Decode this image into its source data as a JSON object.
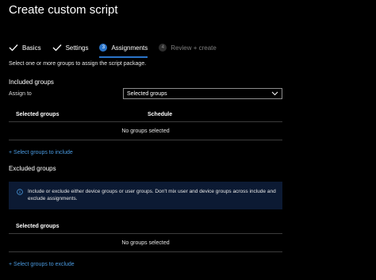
{
  "window": {
    "title": "Create custom script"
  },
  "wizard": {
    "steps": [
      {
        "label": "Basics",
        "state": "done"
      },
      {
        "label": "Settings",
        "state": "done"
      },
      {
        "label": "Assignments",
        "state": "active",
        "number": "3"
      },
      {
        "label": "Review + create",
        "state": "disabled",
        "number": "4"
      }
    ]
  },
  "main": {
    "hint": "Select one or more groups to assign the script package.",
    "included": {
      "title": "Included groups",
      "assign_label": "Assign to",
      "assign_value": "Selected groups",
      "columns": [
        "Selected groups",
        "Schedule"
      ],
      "empty_text": "No groups selected",
      "add_link": "+ Select groups to include"
    },
    "excluded": {
      "title": "Excluded groups",
      "info_text": "Include or exclude either device groups or user groups. Don't mix user and device groups across include and exclude assignments.",
      "columns": [
        "Selected groups"
      ],
      "empty_text": "No groups selected",
      "add_link": "+ Select groups to exclude"
    }
  },
  "colors": {
    "accent": "#2a74c9",
    "link": "#4a9ae0",
    "info_background": "#0c1a33"
  }
}
